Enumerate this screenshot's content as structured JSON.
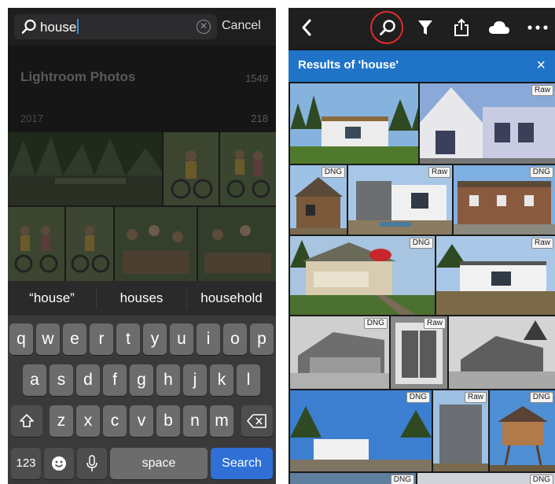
{
  "left_screen": {
    "search": {
      "query": "house",
      "cancel_label": "Cancel"
    },
    "results": [
      {
        "title": "Lightroom Photos",
        "count": "1549"
      },
      {
        "title": "2017",
        "count": "218"
      }
    ],
    "suggestions": [
      "“house”",
      "houses",
      "household"
    ],
    "keyboard": {
      "row1": [
        "q",
        "w",
        "e",
        "r",
        "t",
        "y",
        "u",
        "i",
        "o",
        "p"
      ],
      "row2": [
        "a",
        "s",
        "d",
        "f",
        "g",
        "h",
        "j",
        "k",
        "l"
      ],
      "row3": [
        "z",
        "x",
        "c",
        "v",
        "b",
        "n",
        "m"
      ],
      "numbers_label": "123",
      "space_label": "space",
      "search_label": "Search"
    }
  },
  "right_screen": {
    "results_banner": "Results of 'house'",
    "close_glyph": "×",
    "photos": [
      {
        "badge": ""
      },
      {
        "badge": "Raw"
      },
      {
        "badge": "DNG"
      },
      {
        "badge": "Raw"
      },
      {
        "badge": "DNG"
      },
      {
        "badge": "DNG"
      },
      {
        "badge": "Raw"
      },
      {
        "badge": "DNG"
      },
      {
        "badge": "Raw"
      },
      {
        "badge": ""
      },
      {
        "badge": "DNG"
      },
      {
        "badge": "Raw"
      },
      {
        "badge": "DNG"
      },
      {
        "badge": "DNG"
      },
      {
        "badge": "DNG"
      }
    ]
  },
  "colors": {
    "accent_blue": "#1f74c8",
    "highlight_red": "#e42b2b",
    "keyboard_search": "#2f6fd6"
  },
  "icons": [
    "search-icon",
    "clear-icon",
    "back-icon",
    "filter-icon",
    "share-icon",
    "cloud-icon",
    "more-icon",
    "shift-icon",
    "delete-icon",
    "emoji-icon",
    "microphone-icon"
  ]
}
